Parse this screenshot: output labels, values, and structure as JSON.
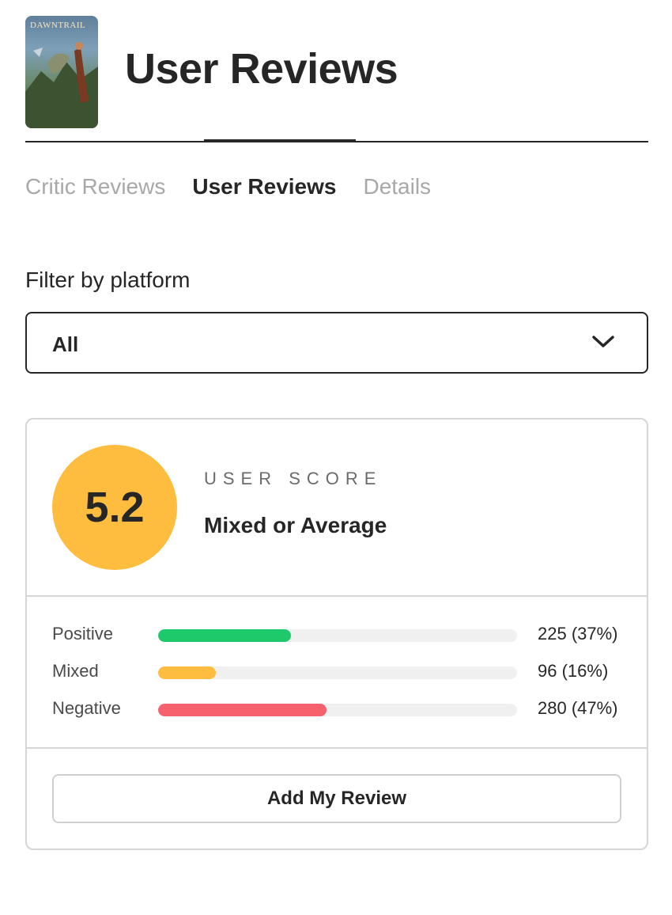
{
  "header": {
    "title": "User Reviews",
    "cover_title": "DAWNTRAIL"
  },
  "tabs": [
    {
      "label": "Critic Reviews",
      "active": false
    },
    {
      "label": "User Reviews",
      "active": true
    },
    {
      "label": "Details",
      "active": false
    }
  ],
  "filter": {
    "label": "Filter by platform",
    "selected": "All",
    "icon": "chevron-down-icon"
  },
  "score": {
    "value": "5.2",
    "label": "USER SCORE",
    "description": "Mixed or Average",
    "color": "#ffbd3f"
  },
  "distribution": [
    {
      "label": "Positive",
      "count": "225 (37%)",
      "percent": 37,
      "color": "#1ec96c"
    },
    {
      "label": "Mixed",
      "count": "96 (16%)",
      "percent": 16,
      "color": "#ffbd3f"
    },
    {
      "label": "Negative",
      "count": "280 (47%)",
      "percent": 47,
      "color": "#f7616d"
    }
  ],
  "actions": {
    "add_review_label": "Add My Review"
  }
}
